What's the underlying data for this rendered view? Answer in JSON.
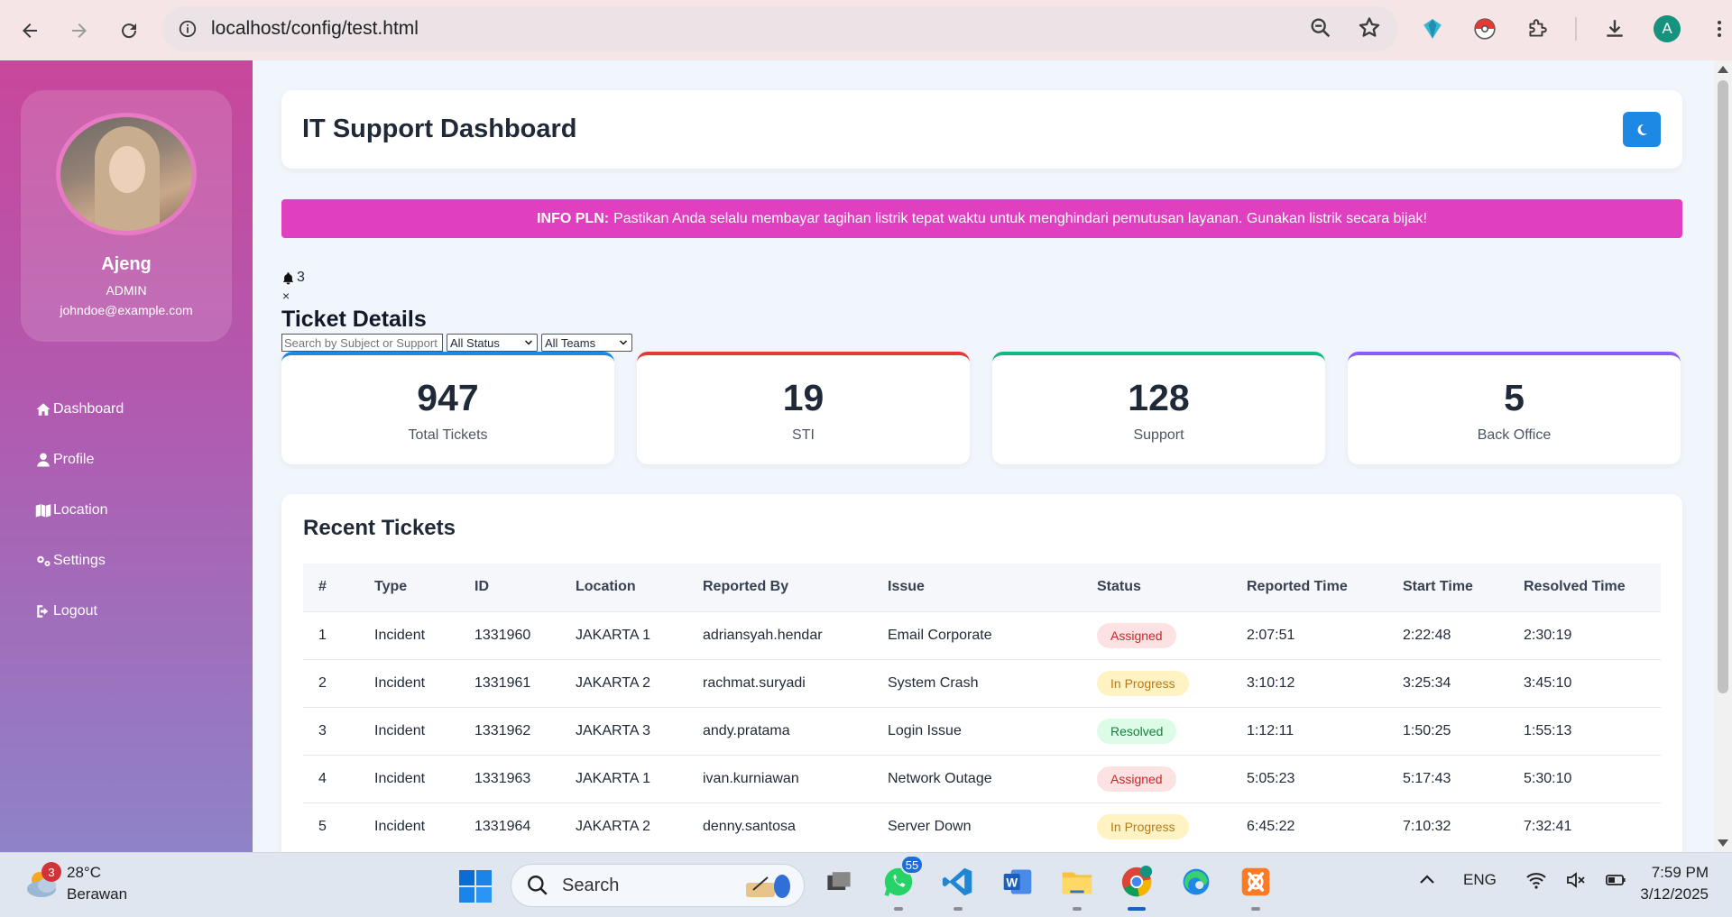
{
  "browser": {
    "url": "localhost/config/test.html"
  },
  "profile": {
    "name": "Ajeng",
    "role": "ADMIN",
    "email": "johndoe@example.com"
  },
  "menu": [
    {
      "label": "Dashboard",
      "icon": "home-icon"
    },
    {
      "label": "Profile",
      "icon": "user-icon"
    },
    {
      "label": "Location",
      "icon": "map-icon"
    },
    {
      "label": "Settings",
      "icon": "cogs-icon"
    },
    {
      "label": "Logout",
      "icon": "logout-icon"
    }
  ],
  "header": {
    "title": "IT Support Dashboard"
  },
  "announcement": {
    "label": "INFO PLN:",
    "text": "Pastikan Anda selalu membayar tagihan listrik tepat waktu untuk menghindari pemutusan layanan. Gunakan listrik secara bijak!"
  },
  "notifications": {
    "count": "3",
    "close": "×"
  },
  "ticket_details": {
    "title": "Ticket Details",
    "search_placeholder": "Search by Subject or Support",
    "status_filter": "All Status",
    "team_filter": "All Teams"
  },
  "stats": [
    {
      "value": "947",
      "label": "Total Tickets",
      "color": "#1e88e5"
    },
    {
      "value": "19",
      "label": "STI",
      "color": "#e53935"
    },
    {
      "value": "128",
      "label": "Support",
      "color": "#10b981"
    },
    {
      "value": "5",
      "label": "Back Office",
      "color": "#8b5cf6"
    }
  ],
  "recent": {
    "title": "Recent Tickets",
    "columns": [
      "#",
      "Type",
      "ID",
      "Location",
      "Reported By",
      "Issue",
      "Status",
      "Reported Time",
      "Start Time",
      "Resolved Time"
    ],
    "rows": [
      {
        "no": "1",
        "type": "Incident",
        "id": "1331960",
        "location": "JAKARTA 1",
        "reporter": "adriansyah.hendar",
        "issue": "Email Corporate",
        "status": "Assigned",
        "reported": "2:07:51",
        "start": "2:22:48",
        "resolved": "2:30:19"
      },
      {
        "no": "2",
        "type": "Incident",
        "id": "1331961",
        "location": "JAKARTA 2",
        "reporter": "rachmat.suryadi",
        "issue": "System Crash",
        "status": "In Progress",
        "reported": "3:10:12",
        "start": "3:25:34",
        "resolved": "3:45:10"
      },
      {
        "no": "3",
        "type": "Incident",
        "id": "1331962",
        "location": "JAKARTA 3",
        "reporter": "andy.pratama",
        "issue": "Login Issue",
        "status": "Resolved",
        "reported": "1:12:11",
        "start": "1:50:25",
        "resolved": "1:55:13"
      },
      {
        "no": "4",
        "type": "Incident",
        "id": "1331963",
        "location": "JAKARTA 1",
        "reporter": "ivan.kurniawan",
        "issue": "Network Outage",
        "status": "Assigned",
        "reported": "5:05:23",
        "start": "5:17:43",
        "resolved": "5:30:10"
      },
      {
        "no": "5",
        "type": "Incident",
        "id": "1331964",
        "location": "JAKARTA 2",
        "reporter": "denny.santosa",
        "issue": "Server Down",
        "status": "In Progress",
        "reported": "6:45:22",
        "start": "7:10:32",
        "resolved": "7:32:41"
      }
    ],
    "status_colors": {
      "Assigned": {
        "bg": "#fde2e4",
        "fg": "#c62828"
      },
      "In Progress": {
        "bg": "#fff3c4",
        "fg": "#b7791f"
      },
      "Resolved": {
        "bg": "#dcfce7",
        "fg": "#15803d"
      }
    }
  },
  "taskbar": {
    "weather_badge": "3",
    "temperature": "28°C",
    "condition": "Berawan",
    "search_label": "Search",
    "whatsapp_count": "55",
    "language": "ENG",
    "time": "7:59 PM",
    "date": "3/12/2025"
  },
  "chrome_avatar_letter": "A"
}
